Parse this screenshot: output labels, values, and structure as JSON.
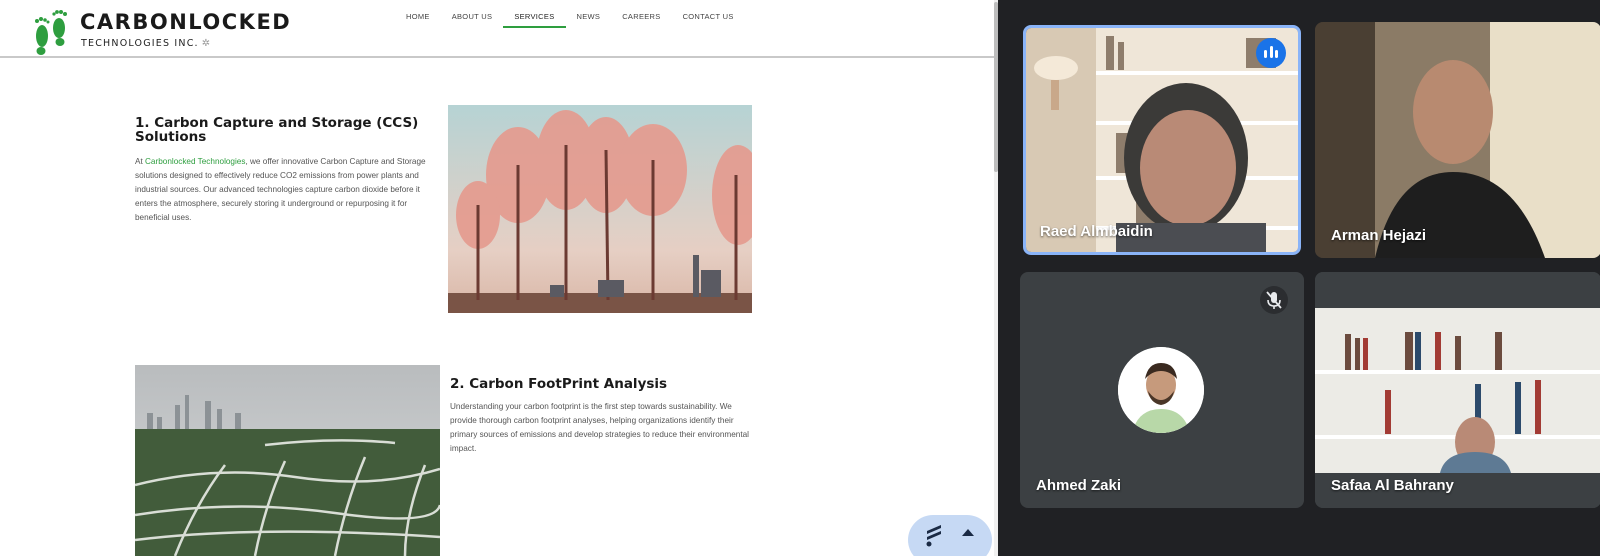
{
  "site": {
    "logo": {
      "name": "CARBONLOCKED",
      "subtitle": "TECHNOLOGIES INC.",
      "leaf_color": "#2e9e3f"
    },
    "nav": [
      "HOME",
      "ABOUT US",
      "SERVICES",
      "NEWS",
      "CAREERS",
      "CONTACT US"
    ],
    "active_nav": "SERVICES",
    "accent_color": "#2e9e3f",
    "section1": {
      "title": "1. Carbon Capture and Storage (CCS) Solutions",
      "body_prefix": "At ",
      "body_highlight": "Carbonlocked Technologies",
      "body_rest": ", we offer innovative Carbon Capture and Storage solutions designed to effectively reduce CO2 emissions from power plants and industrial sources. Our advanced technologies capture carbon dioxide before it enters the atmosphere, securely storing it underground or repurposing it for beneficial uses."
    },
    "section2": {
      "title": "2. Carbon FootPrint Analysis",
      "body": "Understanding your carbon footprint is the first step towards sustainability. We provide thorough carbon footprint analyses, helping organizations identify their primary sources of emissions and develop strategies to reduce their environmental impact."
    }
  },
  "meeting": {
    "participants": [
      {
        "name": "Raed Almbaidin",
        "speaking": true
      },
      {
        "name": "Arman Hejazi"
      },
      {
        "name": "Ahmed Zaki",
        "muted": true
      },
      {
        "name": "Safaa Al Bahrany"
      }
    ],
    "active_speaker_color": "#8ab4f8"
  }
}
